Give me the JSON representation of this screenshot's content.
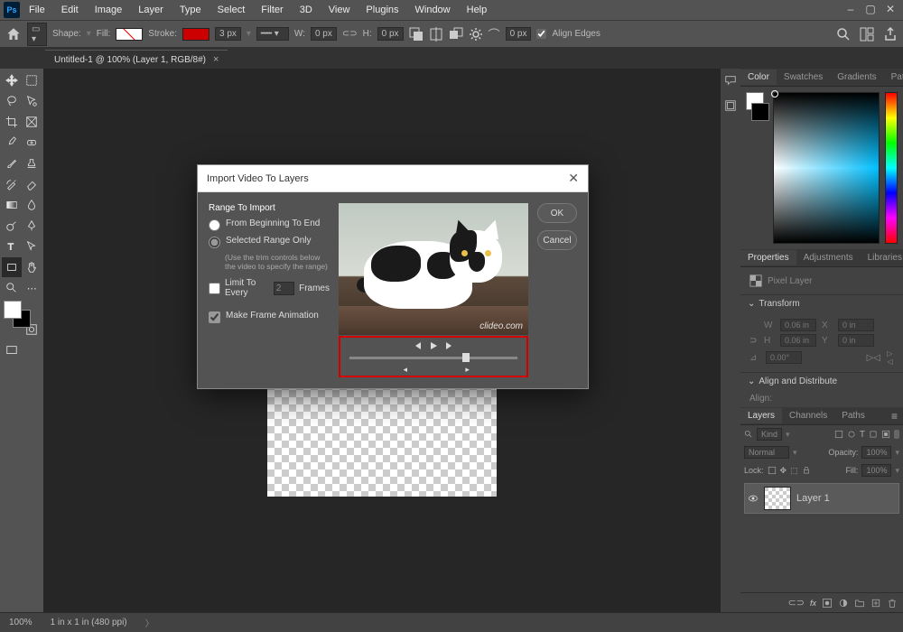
{
  "app": {
    "logo": "Ps"
  },
  "menu": {
    "items": [
      "File",
      "Edit",
      "Image",
      "Layer",
      "Type",
      "Select",
      "Filter",
      "3D",
      "View",
      "Plugins",
      "Window",
      "Help"
    ]
  },
  "optbar": {
    "shape_label": "Shape:",
    "fill_label": "Fill:",
    "stroke_label": "Stroke:",
    "stroke_width": "3 px",
    "w_label": "W:",
    "w_val": "0 px",
    "h_label": "H:",
    "h_val": "0 px",
    "align_edges": "Align Edges"
  },
  "document": {
    "tab_title": "Untitled-1 @ 100% (Layer 1, RGB/8#)"
  },
  "modal": {
    "title": "Import Video To Layers",
    "group": "Range To Import",
    "opt_beginning": "From Beginning To End",
    "opt_selected": "Selected Range Only",
    "hint": "(Use the trim controls below the video to specify the range)",
    "limit_label": "Limit To Every",
    "limit_value": "2",
    "frames_label": "Frames",
    "make_frame": "Make Frame Animation",
    "watermark": "clideo.com",
    "ok": "OK",
    "cancel": "Cancel"
  },
  "panels": {
    "color_tabs": [
      "Color",
      "Swatches",
      "Gradients",
      "Patterns"
    ],
    "props_tabs": [
      "Properties",
      "Adjustments",
      "Libraries"
    ],
    "pixel_layer": "Pixel Layer",
    "transform": "Transform",
    "w_lbl": "W",
    "h_lbl": "H",
    "x_lbl": "X",
    "y_lbl": "Y",
    "w": "0.06 in",
    "h": "0.06 in",
    "x": "0 in",
    "y": "0 in",
    "angle_sym": "⊿",
    "angle": "0.00°",
    "align_dist": "Align and Distribute",
    "align_lbl": "Align:",
    "layers_tabs": [
      "Layers",
      "Channels",
      "Paths"
    ],
    "kind": "Kind",
    "normal": "Normal",
    "opacity_lbl": "Opacity:",
    "opacity": "100%",
    "lock_lbl": "Lock:",
    "fill_lbl": "Fill:",
    "fill": "100%",
    "layer1": "Layer 1"
  },
  "status": {
    "zoom": "100%",
    "info": "1 in x 1 in (480 ppi)"
  }
}
